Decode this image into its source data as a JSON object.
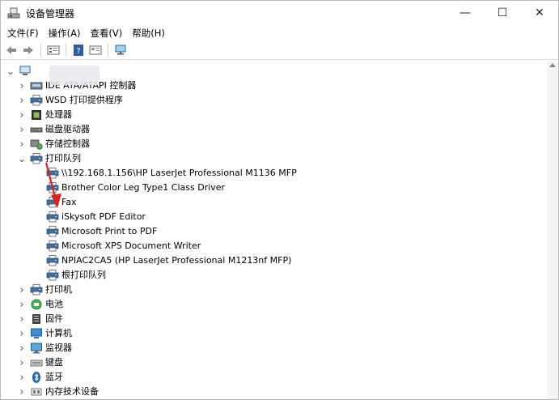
{
  "window": {
    "title": "设备管理器",
    "buttons": {
      "minimize": "—",
      "maximize": "☐",
      "close": "✕"
    }
  },
  "menu": [
    "文件(F)",
    "操作(A)",
    "查看(V)",
    "帮助(H)"
  ],
  "toolbar": [
    "back-icon",
    "forward-icon",
    "properties-icon",
    "help-icon",
    "view-icon",
    "monitor-icon"
  ],
  "tree": {
    "root": "",
    "categories": [
      {
        "label": "IDE ATA/ATAPI 控制器",
        "icon": "ide-controller-icon",
        "expanded": false
      },
      {
        "label": "WSD 打印提供程序",
        "icon": "printer-icon",
        "expanded": false
      },
      {
        "label": "处理器",
        "icon": "processor-icon",
        "expanded": false
      },
      {
        "label": "磁盘驱动器",
        "icon": "disk-drive-icon",
        "expanded": false
      },
      {
        "label": "存储控制器",
        "icon": "storage-controller-icon",
        "expanded": false
      },
      {
        "label": "打印队列",
        "icon": "printer-icon",
        "expanded": true,
        "children": [
          "\\\\192.168.1.156\\HP LaserJet Professional M1136 MFP",
          "Brother Color Leg Type1 Class Driver",
          "Fax",
          "iSkysoft PDF Editor",
          "Microsoft Print to PDF",
          "Microsoft XPS Document Writer",
          "NPIAC2CA5 (HP LaserJet Professional M1213nf MFP)",
          "根打印队列"
        ]
      },
      {
        "label": "打印机",
        "icon": "printer-icon",
        "expanded": false
      },
      {
        "label": "电池",
        "icon": "battery-icon",
        "expanded": false
      },
      {
        "label": "固件",
        "icon": "firmware-icon",
        "expanded": false
      },
      {
        "label": "计算机",
        "icon": "computer-icon",
        "expanded": false
      },
      {
        "label": "监视器",
        "icon": "monitor-icon",
        "expanded": false
      },
      {
        "label": "键盘",
        "icon": "keyboard-icon",
        "expanded": false
      },
      {
        "label": "蓝牙",
        "icon": "bluetooth-icon",
        "expanded": false
      },
      {
        "label": "内存技术设备",
        "icon": "memory-device-icon",
        "expanded": false
      }
    ]
  },
  "colors": {
    "annotation_arrow": "#e02020",
    "bluetooth": "#1565c0",
    "printer": "#3a6fa8"
  }
}
